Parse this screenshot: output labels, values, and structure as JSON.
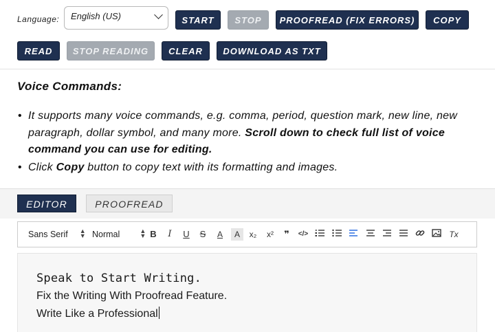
{
  "toolbar": {
    "language_label": "Language:",
    "language_value": "English (US)",
    "buttons": {
      "start": "START",
      "stop": "STOP",
      "proofread": "PROOFREAD (FIX ERRORS)",
      "copy": "COPY",
      "read": "READ",
      "stop_reading": "STOP READING",
      "clear": "CLEAR",
      "download": "DOWNLOAD AS TXT"
    }
  },
  "info": {
    "title": "Voice Commands:",
    "bullet1_text": "It supports many voice commands, e.g. comma, period, question mark, new line, new paragraph, dollar symbol, and many more. ",
    "bullet1_bold": "Scroll down to check full list of voice command you can use for editing.",
    "bullet2_pre": "Click ",
    "bullet2_bold": "Copy",
    "bullet2_post": " button to copy text with its formatting and images."
  },
  "tabs": {
    "editor": "EDITOR",
    "proofread": "PROOFREAD"
  },
  "editor_toolbar": {
    "font": "Sans Serif",
    "size": "Normal",
    "bold": "B",
    "italic": "I",
    "underline": "U",
    "strike": "S",
    "color": "A",
    "background": "A",
    "subscript": "x₂",
    "superscript": "x²",
    "blockquote": "❞",
    "code": "</>",
    "clear": "Tx"
  },
  "editor": {
    "line1": "Speak to Start Writing.",
    "line2": "Fix the Writing With Proofread Feature.",
    "line3": "Write Like a Professional"
  },
  "colors": {
    "primary": "#1f3050",
    "disabled": "#a4aab1",
    "active_align": "#2b6de0"
  }
}
